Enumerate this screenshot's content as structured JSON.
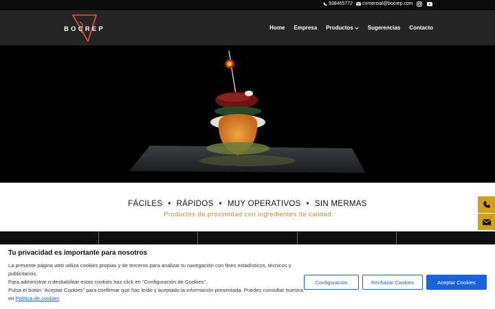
{
  "topbar": {
    "phone": "938465772",
    "email": "comercial@bocrep.com",
    "icons": [
      "phone-icon",
      "mail-icon",
      "instagram-icon",
      "youtube-icon"
    ]
  },
  "header": {
    "logo_text": "BOCREP",
    "nav": [
      {
        "label": "Home"
      },
      {
        "label": "Empresa"
      },
      {
        "label": "Productos",
        "dropdown": true
      },
      {
        "label": "Sugerencias"
      },
      {
        "label": "Contacto"
      }
    ]
  },
  "hero": {
    "description_icon": "food-photo"
  },
  "tagline": {
    "items": [
      "FÁCILES",
      "RÁPIDOS",
      "MUY OPERATIVOS",
      "SIN MERMAS"
    ],
    "separator": "•",
    "subtitle": "Productos de proximidad con ingredientes de calidad"
  },
  "side_buttons": [
    "phone-icon",
    "mail-icon"
  ],
  "cookie": {
    "title": "Tu privacidad es importante para nosotros",
    "line1": "La presente página web utiliza cookies propias y de terceros para analizar tu navegación con fines estadísticos, técnicos y publicitarios.",
    "line2": "Para administrar o deshabilitar estas cookies haz click en “Configuración de Cookies”.",
    "line3": "Pulsa el botón “Aceptar Cookies” para confirmar que has leído y aceptado la información presentada. Puedes consultar nuestra en",
    "policy_link": "Política de cookies",
    "btn_config": "Configuración",
    "btn_reject": "Rechazar Cookies",
    "btn_accept": "Aceptar Cookies"
  },
  "colors": {
    "accent": "#d4a017",
    "gold_text": "#b7902f",
    "cookie_blue": "#1863dc",
    "header_bg": "#252525"
  }
}
